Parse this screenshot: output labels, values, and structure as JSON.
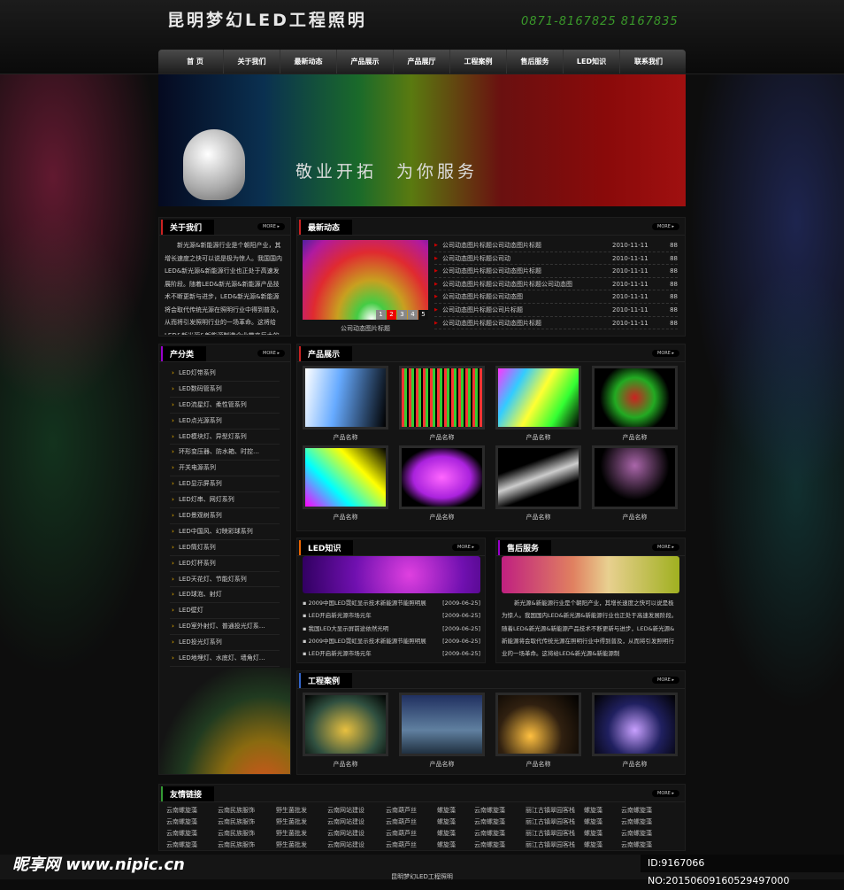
{
  "header": {
    "logo": "昆明梦幻LED工程照明",
    "phone": "0871-8167825  8167835"
  },
  "nav": [
    "首 页",
    "关于我们",
    "最新动态",
    "产品展示",
    "产品展厅",
    "工程案例",
    "售后服务",
    "LED知识",
    "联系我们"
  ],
  "banner": {
    "slogan": "敬业开拓  为你服务"
  },
  "more": "MORE ▸",
  "about": {
    "title": "关于我们",
    "text": "新光源&新能源行业是个朝阳产业，其增长速度之快可以说是极为惊人。我国国内LED&新光源&新能源行业也正处于高速发展阶段。随着LED&新光源&新能源产品技术不断更新与进步，LED&新光源&新能源将会取代传统光源在照明行业中得到普及，从而将引发照明行业的一场革命。这将给LED&新光源&新能源制造企业带来巨大的机遇与挑战"
  },
  "news": {
    "title": "最新动态",
    "pager": [
      "1",
      "2",
      "3",
      "4",
      "5"
    ],
    "caption": "公司动态图片标题",
    "items": [
      {
        "title": "公司动态图片标题公司动态图片标题",
        "date": "2010-11-11",
        "count": "88"
      },
      {
        "title": "公司动态图片标题公司动",
        "date": "2010-11-11",
        "count": "88"
      },
      {
        "title": "公司动态图片标题公司动态图片标题",
        "date": "2010-11-11",
        "count": "88"
      },
      {
        "title": "公司动态图片标题公司动态图片标题公司动态图",
        "date": "2010-11-11",
        "count": "88"
      },
      {
        "title": "公司动态图片标题公司动态图",
        "date": "2010-11-11",
        "count": "88"
      },
      {
        "title": "公司动态图片标题公司片标题",
        "date": "2010-11-11",
        "count": "88"
      },
      {
        "title": "公司动态图片标题公司动态图片标题",
        "date": "2010-11-11",
        "count": "88"
      }
    ]
  },
  "categories": {
    "title": "产分类",
    "items": [
      "LED灯带系列",
      "LED数码管系列",
      "LED流星灯、柔性管系列",
      "LED点光源系列",
      "LED模块灯、异型灯系列",
      "环形变压器、防水箱、时控…",
      "开关电源系列",
      "LED显示屏系列",
      "LED灯串、网灯系列",
      "LED景观树系列",
      "LED中国风、幻映彩球系列",
      "LED筒灯系列",
      "LED灯杯系列",
      "LED天花灯、节能灯系列",
      "LED球泡、射灯",
      "LED壁灯",
      "LED室外射灯、普通投光灯系…",
      "LED投光灯系列",
      "LED地埋灯、水底灯、墙角灯…"
    ]
  },
  "products": {
    "title": "产品展示",
    "items": [
      "产品名称",
      "产品名称",
      "产品名称",
      "产品名称",
      "产品名称",
      "产品名称",
      "产品名称",
      "产品名称"
    ]
  },
  "knowledge": {
    "title": "LED知识",
    "items": [
      {
        "title": "▪ 2009中国LED霓虹显示技术新能源节能照明展",
        "date": "[2009-06-25]"
      },
      {
        "title": "▪ LED开启新光源市场元年",
        "date": "[2009-06-25]"
      },
      {
        "title": "▪ 我国LED大显示屏前途依然光明",
        "date": "[2009-06-25]"
      },
      {
        "title": "▪ 2009中国LED霓虹显示技术新能源节能照明展",
        "date": "[2009-06-25]"
      },
      {
        "title": "▪ LED开启新光源市场元年",
        "date": "[2009-06-25]"
      }
    ]
  },
  "service": {
    "title": "售后服务",
    "text": "新光源&新能源行业是个朝阳产业，其增长速度之快可以说是极为惊人。我国国内LED&新光源&新能源行业也正处于高速发展阶段。随着LED&新光源&新能源产品技术不断更新与进步，LED&新光源&新能源将会取代传统光源在照明行业中得到普及，从而将引发照明行业的一场革命。这将给LED&新光源&新能源制"
  },
  "cases": {
    "title": "工程案例",
    "items": [
      "产品名称",
      "产品名称",
      "产品名称",
      "产品名称"
    ]
  },
  "links": {
    "title": "友情链接",
    "row": [
      "云南螺旋藻",
      "云南民族服饰",
      "野生菌批发",
      "云南网站建设",
      "云南葫芦丝",
      "螺旋藻",
      "云南螺旋藻",
      "丽江古镇翠园客栈",
      "螺旋藻",
      "云南螺旋藻"
    ]
  },
  "footer": {
    "text": "昆明梦幻LED工程照明"
  },
  "watermark": {
    "site": "昵享网 www.nipic.cn",
    "id": "ID:9167066 NO:20150609160529497000"
  },
  "colors": {
    "accent": "#cc2222",
    "phone": "#3a9a2a"
  }
}
